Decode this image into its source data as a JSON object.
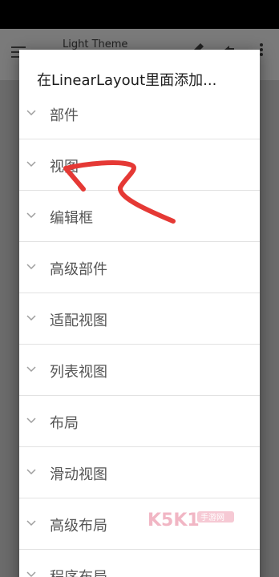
{
  "app_bar": {
    "title": "Light Theme"
  },
  "dialog": {
    "title": "在LinearLayout里面添加...",
    "items": [
      {
        "label": "部件"
      },
      {
        "label": "视图"
      },
      {
        "label": "编辑框"
      },
      {
        "label": "高级部件"
      },
      {
        "label": "适配视图"
      },
      {
        "label": "列表视图"
      },
      {
        "label": "布局"
      },
      {
        "label": "滑动视图"
      },
      {
        "label": "高级布局"
      },
      {
        "label": "程序布局"
      }
    ]
  },
  "watermark": {
    "text": "K5K1手游网"
  },
  "colors": {
    "annotation": "#e53935",
    "chevron": "#9e9e9e"
  }
}
